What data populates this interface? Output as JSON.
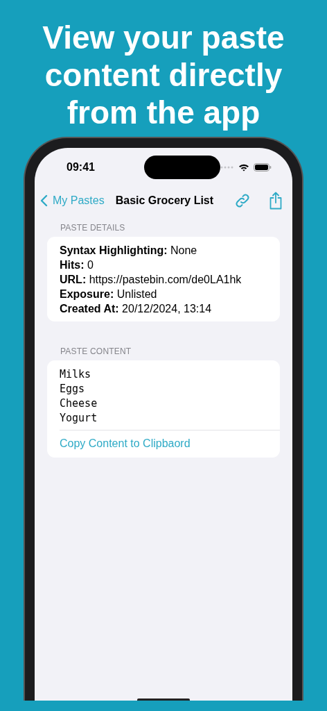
{
  "headline": "View your paste content directly from the app",
  "status_bar": {
    "time": "09:41"
  },
  "nav": {
    "back_label": "My Pastes",
    "title": "Basic Grocery List"
  },
  "sections": [
    {
      "kind": "details",
      "header": "PASTE DETAILS",
      "fields": [
        "**Syntax Highlighting:** None",
        "**Hits:** 0",
        "**URL:** https://pastebin.com/de0LA1hk",
        "**Exposure:** Unlisted",
        "**Created At:** 20/12/2024, 13:14"
      ]
    },
    {
      "kind": "content",
      "header": "PASTE CONTENT",
      "lines": [
        "Milks",
        "Eggs",
        "Cheese",
        "Yogurt"
      ],
      "action": "Copy Content to Clipbaord"
    }
  ]
}
